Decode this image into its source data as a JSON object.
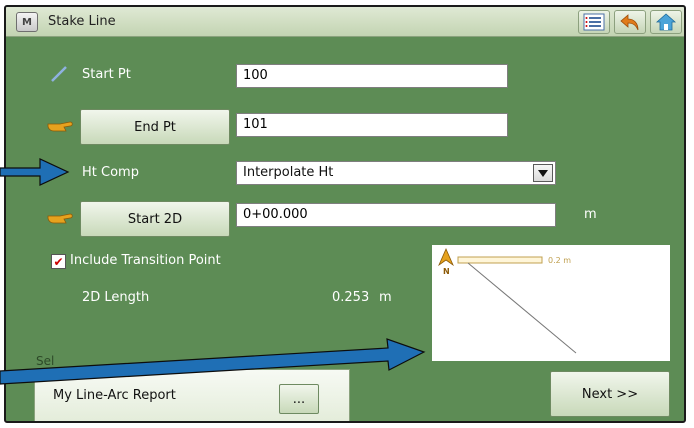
{
  "window": {
    "title": "Stake Line",
    "app_icon_letter": "M"
  },
  "toolbar": {
    "icons": [
      "list-icon",
      "back-arrow-icon",
      "home-icon"
    ]
  },
  "start_pt": {
    "label": "Start Pt",
    "value": "100"
  },
  "end_pt": {
    "button_label": "End Pt",
    "value": "101"
  },
  "ht_comp": {
    "label": "Ht Comp",
    "selected": "Interpolate Ht"
  },
  "start_2d": {
    "button_label": "Start 2D",
    "value": "0+00.000",
    "unit": "m"
  },
  "transition": {
    "label": "Include Transition Point",
    "checked": true
  },
  "length_2d": {
    "label": "2D Length",
    "value": "0.253",
    "unit": "m"
  },
  "preview": {
    "scale_label": "0.2 m",
    "north_label": "N"
  },
  "report": {
    "value": "My Line-Arc Report",
    "browse_label": "...",
    "caption_partial": "Sel"
  },
  "next_button": {
    "label": "Next >>"
  },
  "colors": {
    "panel": "#5d8c55",
    "annotation_arrow": "#1f6fb5",
    "titlebar": "#d4e1c7"
  }
}
